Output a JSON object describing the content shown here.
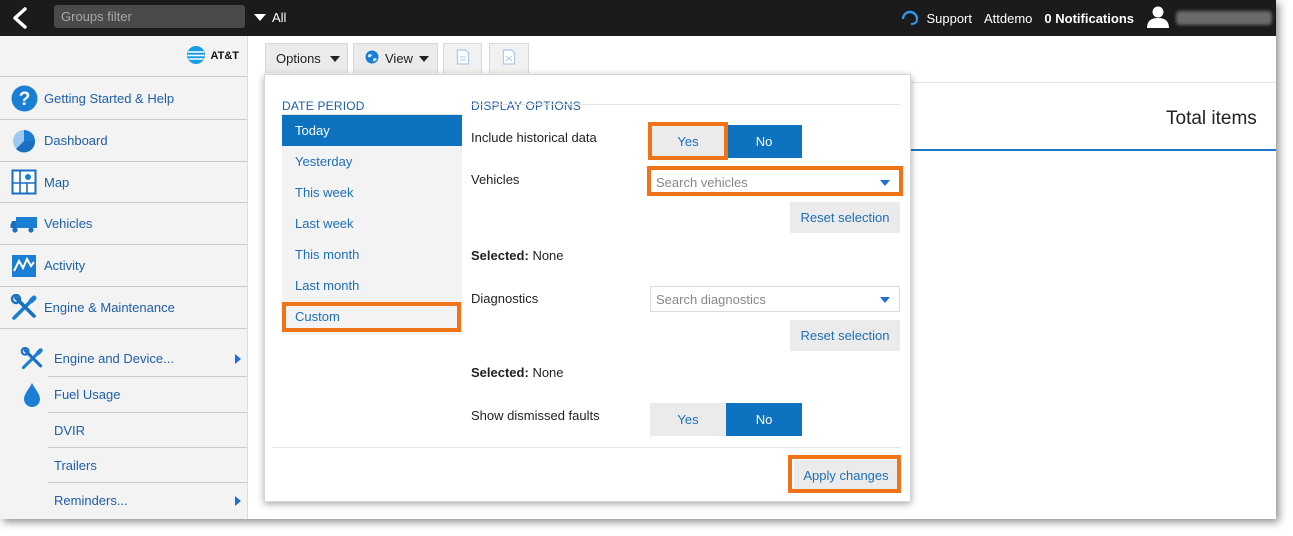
{
  "topbar": {
    "groups_filter_placeholder": "Groups filter",
    "all_label": "All",
    "support_label": "Support",
    "company_label": "Attdemo",
    "notifications_label": "0 Notifications"
  },
  "sidebar": {
    "brand": "AT&T",
    "items": [
      {
        "label": "Getting Started & Help"
      },
      {
        "label": "Dashboard"
      },
      {
        "label": "Map"
      },
      {
        "label": "Vehicles"
      },
      {
        "label": "Activity"
      },
      {
        "label": "Engine & Maintenance"
      }
    ],
    "subitems": [
      {
        "label": "Engine and Device..."
      },
      {
        "label": "Fuel Usage"
      },
      {
        "label": "DVIR"
      },
      {
        "label": "Trailers"
      },
      {
        "label": "Reminders..."
      }
    ]
  },
  "toolbar": {
    "options_label": "Options",
    "view_label": "View"
  },
  "report": {
    "total_items_label": "Total items"
  },
  "options_panel": {
    "date_period_title": "DATE PERIOD",
    "display_options_title": "DISPLAY OPTIONS",
    "periods": [
      "Today",
      "Yesterday",
      "This week",
      "Last week",
      "This month",
      "Last month",
      "Custom"
    ],
    "selected_period": "Today",
    "historical_label": "Include historical data",
    "historical_yes": "Yes",
    "historical_no": "No",
    "vehicles_label": "Vehicles",
    "vehicles_placeholder": "Search vehicles",
    "reset_label": "Reset selection",
    "selected_prefix": "Selected:",
    "vehicles_selected_value": "None",
    "diagnostics_label": "Diagnostics",
    "diagnostics_placeholder": "Search diagnostics",
    "diagnostics_selected_value": "None",
    "dismissed_label": "Show dismissed faults",
    "dismissed_yes": "Yes",
    "dismissed_no": "No",
    "apply_label": "Apply changes"
  },
  "colors": {
    "accent_blue": "#0d72bf",
    "highlight_orange": "#f07318",
    "topbar_bg": "#1b1b1b"
  }
}
